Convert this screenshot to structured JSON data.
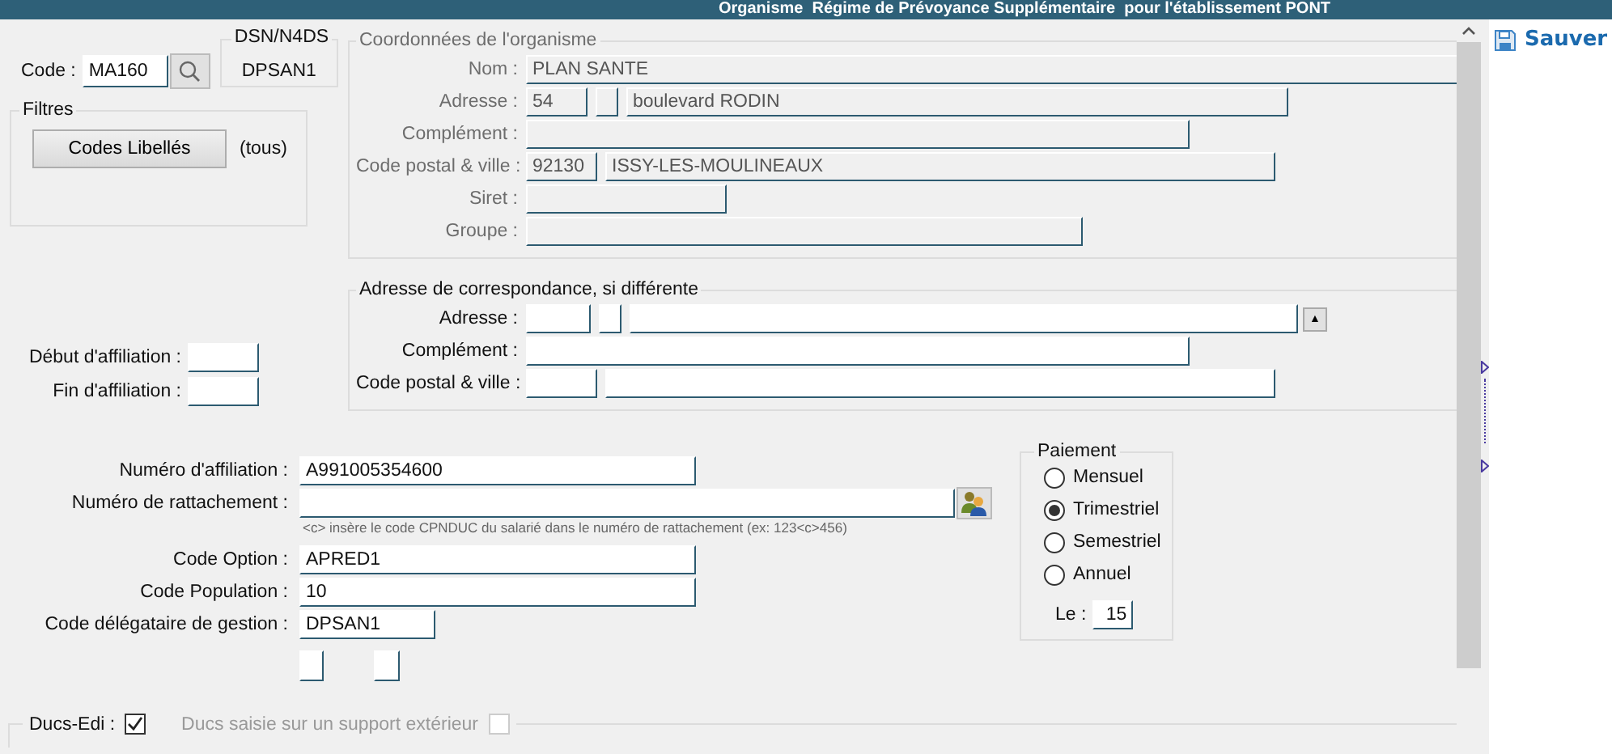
{
  "window": {
    "title": "Organisme  Régime de Prévoyance Supplémentaire  pour l'établissement PONT"
  },
  "code": {
    "label": "Code :",
    "value": "MA160"
  },
  "dsn": {
    "label": "DSN/N4DS",
    "value": "DPSAN1"
  },
  "filters": {
    "title": "Filtres",
    "button": "Codes Libellés",
    "scope": "(tous)"
  },
  "organisme": {
    "title": "Coordonnées de l'organisme",
    "disabled": true,
    "rows": [
      {
        "kind": "wide",
        "label": "Nom :",
        "value": "PLAN SANTE"
      },
      {
        "kind": "address",
        "label": "Adresse :",
        "number": "54",
        "street": "boulevard RODIN"
      },
      {
        "kind": "line",
        "label": "Complément :"
      },
      {
        "kind": "postal",
        "label": "Code postal & ville :",
        "postcode": "92130",
        "city": "ISSY-LES-MOULINEAUX"
      },
      {
        "kind": "short",
        "label": "Siret :"
      },
      {
        "kind": "medium",
        "label": "Groupe :"
      }
    ]
  },
  "correspondance": {
    "title": "Adresse de correspondance, si différente",
    "disabled": false,
    "rows": [
      {
        "kind": "address",
        "label": "Adresse :",
        "button": "▲"
      },
      {
        "kind": "line",
        "label": "Complément :"
      },
      {
        "kind": "postal",
        "label": "Code postal & ville :"
      }
    ]
  },
  "affiliation": {
    "start_label": "Début d'affiliation :",
    "end_label": "Fin d'affiliation :"
  },
  "details": [
    {
      "kind": "text",
      "label": "Numéro d'affiliation :",
      "value": "A991005354600"
    },
    {
      "kind": "lookup",
      "label": "Numéro de rattachement :",
      "hint": "<c> insère le code CPNDUC du salarié dans le numéro de rattachement (ex: 123<c>456)"
    },
    {
      "kind": "text",
      "label": "Code Option :",
      "value": "APRED1"
    },
    {
      "kind": "text",
      "label": "Code Population :",
      "value": "10"
    },
    {
      "kind": "short",
      "label": "Code délégataire de gestion :",
      "value": "DPSAN1"
    }
  ],
  "payment": {
    "title": "Paiement",
    "options": [
      {
        "label": "Mensuel",
        "selected": false
      },
      {
        "label": "Trimestriel",
        "selected": true
      },
      {
        "label": "Semestriel",
        "selected": false
      },
      {
        "label": "Annuel",
        "selected": false
      }
    ],
    "day_label": "Le :",
    "day": "15"
  },
  "ducs": {
    "label": "Ducs-Edi :",
    "checked": true,
    "external_label": "Ducs saisie sur un support extérieur",
    "external_checked": false
  },
  "sidebar": {
    "save": "Sauver"
  }
}
